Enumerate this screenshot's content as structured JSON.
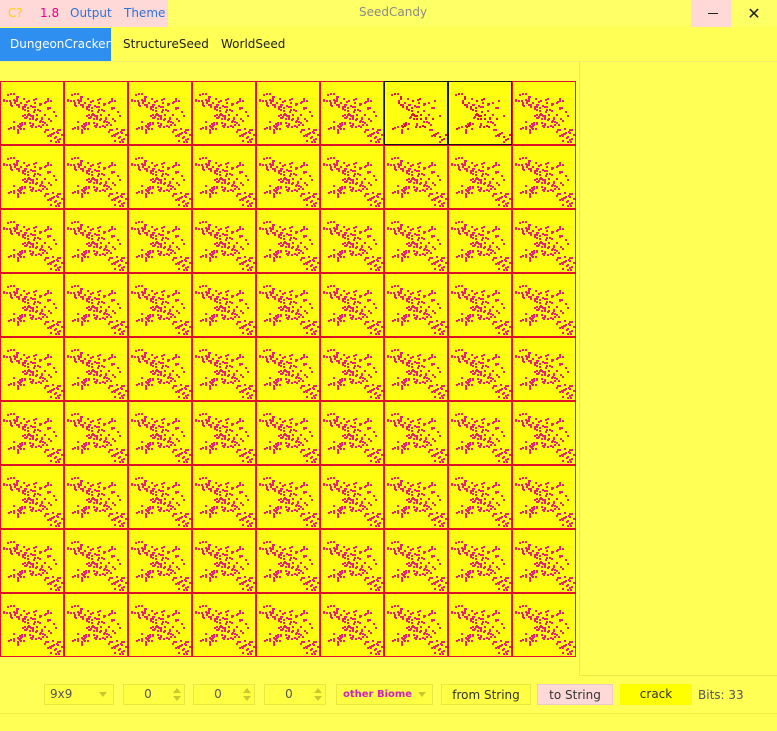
{
  "menu": [
    "C?",
    "1.8",
    "Output",
    "Theme"
  ],
  "window": {
    "title": "SeedCandy"
  },
  "tabs": [
    {
      "label": "DungeonCracker",
      "active": true
    },
    {
      "label": "StructureSeed",
      "active": false
    },
    {
      "label": "WorldSeed",
      "active": false
    }
  ],
  "grid": {
    "rows": 9,
    "cols": 9,
    "selected": [
      [
        0,
        6
      ],
      [
        0,
        7
      ]
    ]
  },
  "toolbar": {
    "size": "9x9",
    "spin_values": [
      "0",
      "0",
      "0"
    ],
    "biome": "other Biome",
    "from_string": "from String",
    "to_string": "to String",
    "crack": "crack",
    "bits": "Bits: 33"
  },
  "colors": {
    "background": "#ffff55",
    "cell_border": "#e0102a",
    "pattern": "#e8207a",
    "tab_active": "#2e8ff0"
  }
}
